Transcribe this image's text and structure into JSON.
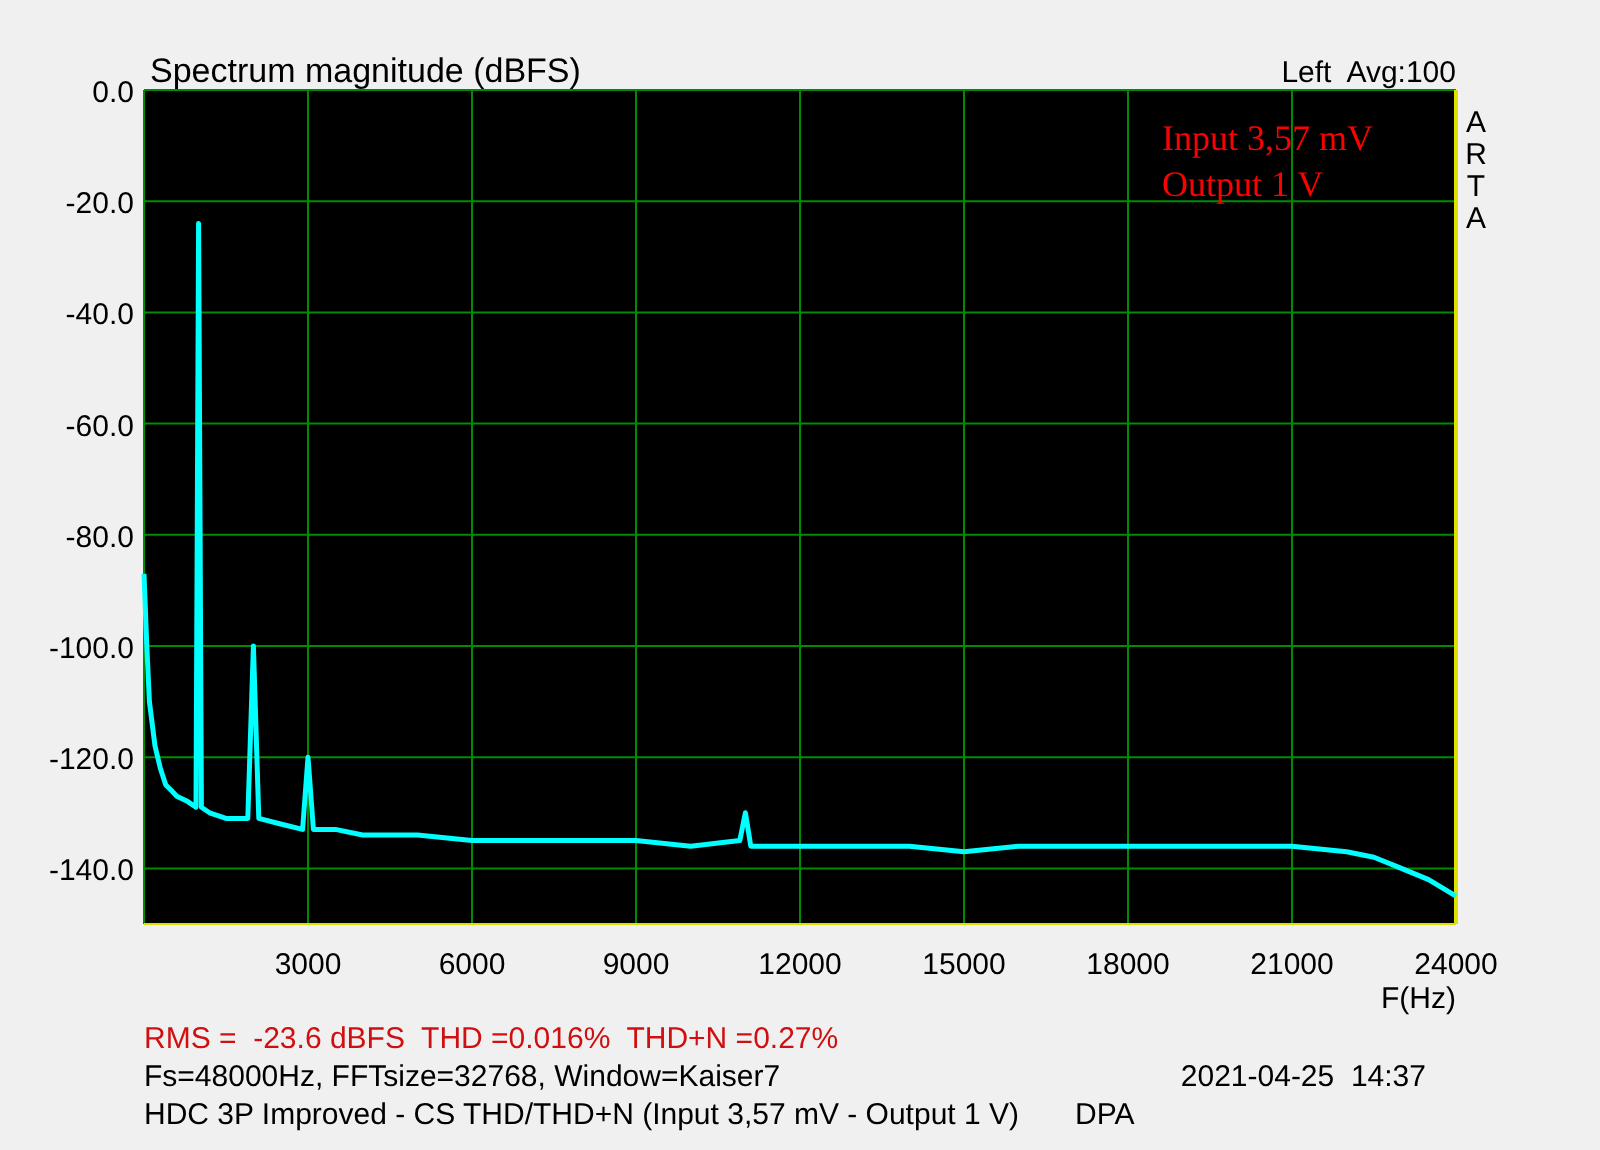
{
  "chart": {
    "channel_info": "Left  Avg:100",
    "brand": "ARTA",
    "legend_lines": [
      "Input 3,57 mV",
      "Output 1 V"
    ],
    "chart_data": {
      "type": "line",
      "title": "Spectrum magnitude (dBFS)",
      "xlabel": "F(Hz)",
      "xlim": [
        0,
        24000
      ],
      "grid": true,
      "ylim": [
        -150,
        0
      ],
      "xticks": [
        3000,
        6000,
        9000,
        12000,
        15000,
        18000,
        21000,
        24000
      ],
      "yticks": [
        {
          "value": 0,
          "label": "0.0"
        },
        {
          "value": -20,
          "label": "-20.0"
        },
        {
          "value": -40,
          "label": "-40.0"
        },
        {
          "value": -60,
          "label": "-60.0"
        },
        {
          "value": -80,
          "label": "-80.0"
        },
        {
          "value": -100,
          "label": "-100.0"
        },
        {
          "value": -120,
          "label": "-120.0"
        },
        {
          "value": -140,
          "label": "-140.0"
        }
      ],
      "x": [
        0,
        50,
        100,
        200,
        300,
        400,
        500,
        600,
        800,
        950,
        1000,
        1050,
        1200,
        1500,
        1900,
        2000,
        2100,
        2500,
        2900,
        3000,
        3100,
        3500,
        4000,
        5000,
        6000,
        7000,
        8000,
        9000,
        10000,
        10900,
        11000,
        11100,
        12000,
        13000,
        14000,
        15000,
        16000,
        17000,
        18000,
        19000,
        20000,
        21000,
        22000,
        22500,
        23000,
        23500,
        24000
      ],
      "series": [
        {
          "color": "#00ffff",
          "values": [
            -87,
            -100,
            -110,
            -118,
            -122,
            -125,
            -126,
            -127,
            -128,
            -129,
            -24,
            -129,
            -130,
            -131,
            -131,
            -100,
            -131,
            -132,
            -133,
            -120,
            -133,
            -133,
            -134,
            -134,
            -135,
            -135,
            -135,
            -135,
            -136,
            -135,
            -130,
            -136,
            -136,
            -136,
            -136,
            -137,
            -136,
            -136,
            -136,
            -136,
            -136,
            -136,
            -137,
            -138,
            -140,
            -142,
            -145
          ]
        }
      ]
    }
  },
  "footer": {
    "stats": "RMS =  -23.6 dBFS  THD =0.016%  THD+N =0.27%",
    "settings": "Fs=48000Hz, FFTsize=32768, Window=Kaiser7",
    "timestamp": "2021-04-25  14:37",
    "description": "HDC 3P Improved - CS THD/THD+N (Input 3,57 mV - Output 1 V)",
    "author": "DPA"
  }
}
